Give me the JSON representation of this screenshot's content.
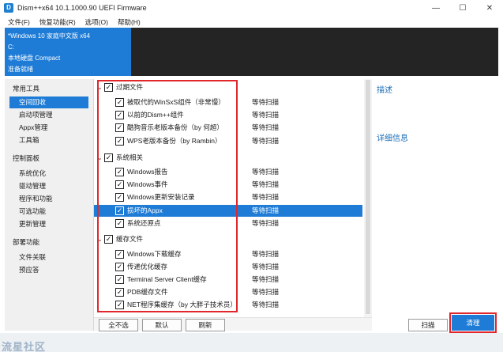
{
  "window": {
    "title": "Dism++x64 10.1.1000.90 UEFI Firmware",
    "icon_glyph": "D",
    "minimize": "—",
    "maximize": "☐",
    "close": "✕"
  },
  "menu": [
    "文件(F)",
    "恢复功能(R)",
    "选项(O)",
    "帮助(H)"
  ],
  "os_info": {
    "name": "*Windows 10 家庭中文版 x64",
    "drive": "C:",
    "disk": "本地硬盘 Compact",
    "state": "准备就绪"
  },
  "sidebar": {
    "groups": [
      {
        "label": "常用工具",
        "items": [
          "空间回收",
          "启动项管理",
          "Appx管理",
          "工具箱"
        ]
      },
      {
        "label": "控制面板",
        "items": [
          "系统优化",
          "驱动管理",
          "程序和功能",
          "可选功能",
          "更新管理"
        ]
      },
      {
        "label": "部署功能",
        "items": [
          "文件关联",
          "预应答"
        ]
      }
    ],
    "active_item": "空间回收"
  },
  "cleanup_list": [
    {
      "kind": "group",
      "label": "过期文件",
      "checked": true
    },
    {
      "kind": "item",
      "label": "被取代的WinSxS组件（非常慢）",
      "status": "等待扫描",
      "checked": true
    },
    {
      "kind": "item",
      "label": "以前的Dism++组件",
      "status": "等待扫描",
      "checked": true
    },
    {
      "kind": "item",
      "label": "酷狗音乐老版本备份（by 何超）",
      "status": "等待扫描",
      "checked": true
    },
    {
      "kind": "item",
      "label": "WPS老版本备份（by Rambin）",
      "status": "等待扫描",
      "checked": true
    },
    {
      "kind": "group",
      "label": "系统相关",
      "checked": true
    },
    {
      "kind": "item",
      "label": "Windows报告",
      "status": "等待扫描",
      "checked": true
    },
    {
      "kind": "item",
      "label": "Windows事件",
      "status": "等待扫描",
      "checked": true
    },
    {
      "kind": "item",
      "label": "Windows更新安装记录",
      "status": "等待扫描",
      "checked": true
    },
    {
      "kind": "item",
      "label": "损坏的Appx",
      "status": "等待扫描",
      "checked": true,
      "selected": true
    },
    {
      "kind": "item",
      "label": "系统还原点",
      "status": "等待扫描",
      "checked": true
    },
    {
      "kind": "group",
      "label": "缓存文件",
      "checked": true
    },
    {
      "kind": "item",
      "label": "Windows下载缓存",
      "status": "等待扫描",
      "checked": true
    },
    {
      "kind": "item",
      "label": "传递优化缓存",
      "status": "等待扫描",
      "checked": true
    },
    {
      "kind": "item",
      "label": "Terminal Server Client缓存",
      "status": "等待扫描",
      "checked": true
    },
    {
      "kind": "item",
      "label": "PDB缓存文件",
      "status": "等待扫描",
      "checked": true
    },
    {
      "kind": "item",
      "label": "NET程序集缓存（by 大胖子技术员）",
      "status": "等待扫描",
      "checked": true
    }
  ],
  "check_glyph": "✓",
  "chevron_glyph": "⌄",
  "right_panel": {
    "description_title": "描述",
    "details_title": "详细信息"
  },
  "buttons": {
    "select_none": "全不选",
    "default": "默认",
    "refresh": "刷新",
    "scan": "扫描",
    "clean": "清理"
  },
  "watermark": "流星社区"
}
